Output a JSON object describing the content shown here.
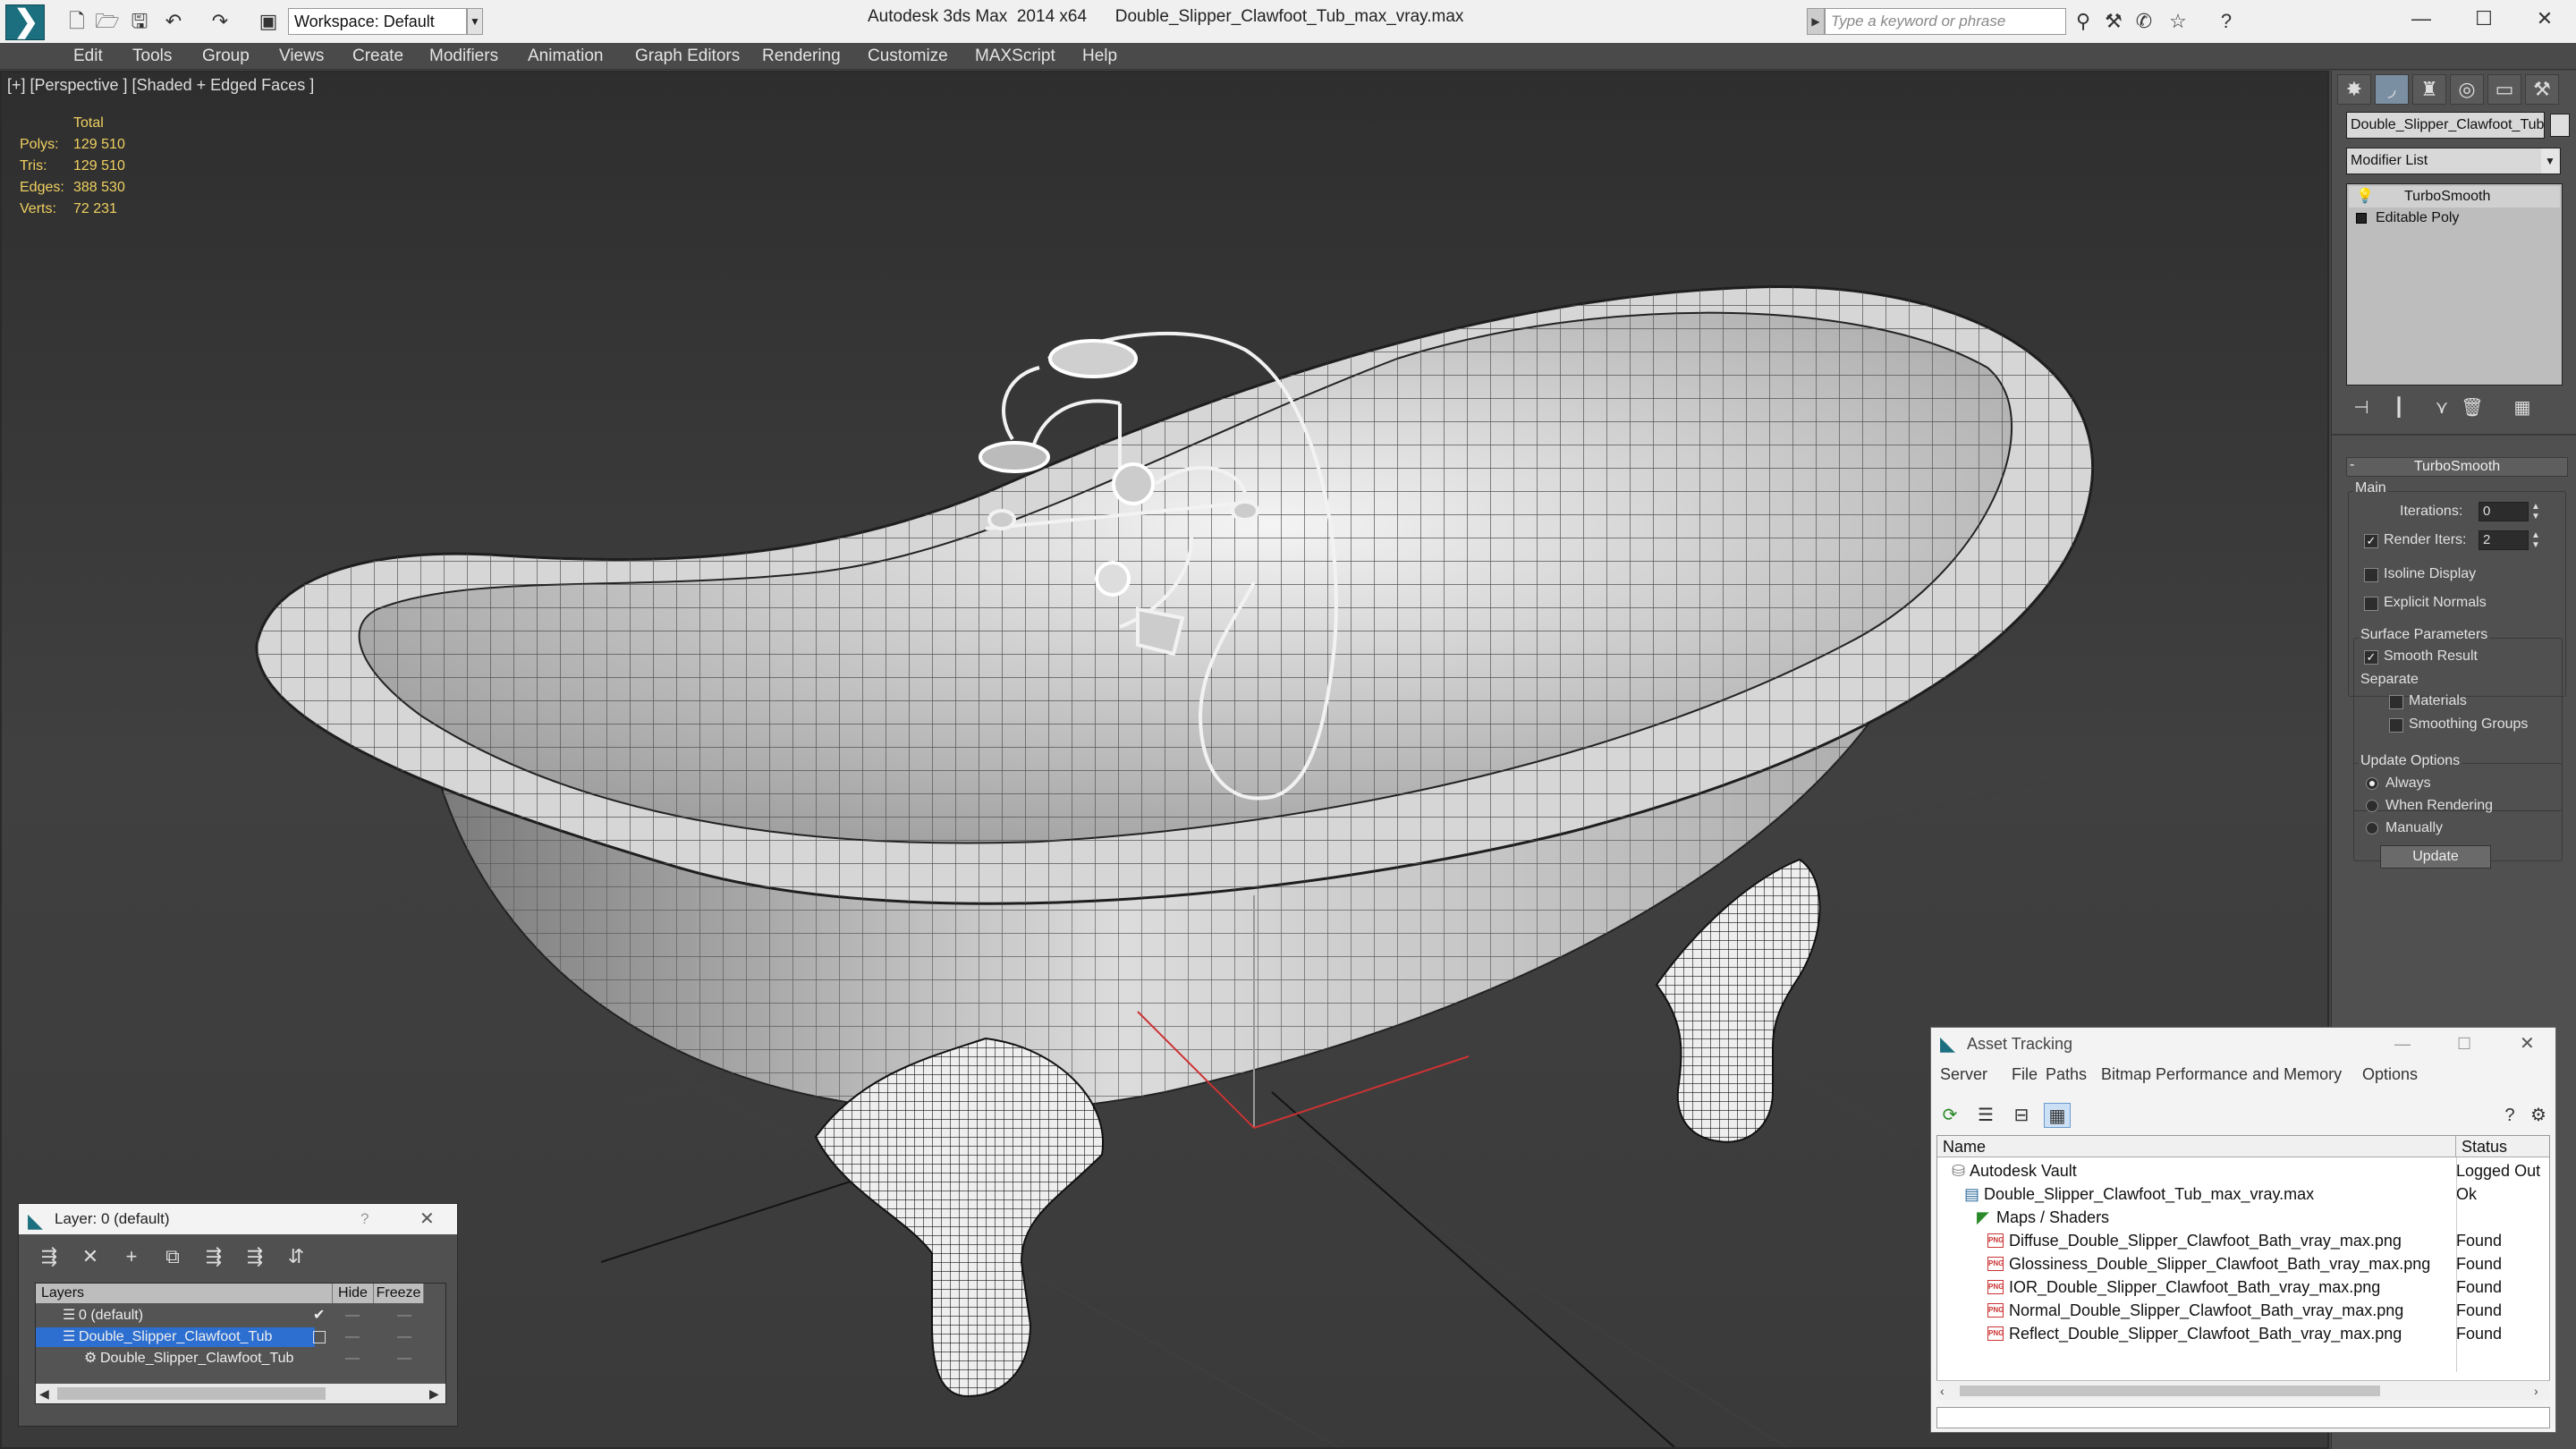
{
  "titlebar": {
    "workspace": "Workspace: Default",
    "app_title": "Autodesk 3ds Max  2014 x64",
    "file_title": "Double_Slipper_Clawfoot_Tub_max_vray.max",
    "search_placeholder": "Type a keyword or phrase"
  },
  "menu": [
    "Edit",
    "Tools",
    "Group",
    "Views",
    "Create",
    "Modifiers",
    "Animation",
    "Graph Editors",
    "Rendering",
    "Customize",
    "MAXScript",
    "Help"
  ],
  "viewport": {
    "label": "[+] [Perspective ] [Shaded + Edged Faces ]",
    "stats": {
      "header": "Total",
      "labels": [
        "Polys:",
        "Tris:",
        "Edges:",
        "Verts:"
      ],
      "values": [
        "129 510",
        "129 510",
        "388 530",
        "72 231"
      ]
    }
  },
  "command_panel": {
    "object_name": "Double_Slipper_Clawfoot_Tub",
    "modifier_list": "Modifier List",
    "stack": [
      "TurboSmooth",
      "Editable Poly"
    ],
    "rollout_title": "TurboSmooth",
    "main_group": "Main",
    "iterations_label": "Iterations:",
    "iterations_value": "0",
    "render_iters_label": "Render Iters:",
    "render_iters_value": "2",
    "isoline": "Isoline Display",
    "explicit_normals": "Explicit Normals",
    "surface_group": "Surface Parameters",
    "smooth_result": "Smooth Result",
    "separate": "Separate",
    "materials": "Materials",
    "smoothing_groups": "Smoothing Groups",
    "update_group": "Update Options",
    "always": "Always",
    "when_rendering": "When Rendering",
    "manually": "Manually",
    "update_btn": "Update"
  },
  "layer_window": {
    "title": "Layer: 0 (default)",
    "help": "?",
    "headers": [
      "Layers",
      "Hide",
      "Freeze"
    ],
    "rows": [
      "0 (default)",
      "Double_Slipper_Clawfoot_Tub",
      "Double_Slipper_Clawfoot_Tub"
    ]
  },
  "asset_window": {
    "title": "Asset Tracking",
    "menu": [
      "Server",
      "File",
      "Paths",
      "Bitmap Performance and Memory",
      "Options"
    ],
    "headers": [
      "Name",
      "Status"
    ],
    "rows": [
      {
        "name": "Autodesk Vault",
        "status": "Logged Out"
      },
      {
        "name": "Double_Slipper_Clawfoot_Tub_max_vray.max",
        "status": "Ok"
      },
      {
        "name": "Maps / Shaders",
        "status": ""
      },
      {
        "name": "Diffuse_Double_Slipper_Clawfoot_Bath_vray_max.png",
        "status": "Found"
      },
      {
        "name": "Glossiness_Double_Slipper_Clawfoot_Bath_vray_max.png",
        "status": "Found"
      },
      {
        "name": "IOR_Double_Slipper_Clawfoot_Bath_vray_max.png",
        "status": "Found"
      },
      {
        "name": "Normal_Double_Slipper_Clawfoot_Bath_vray_max.png",
        "status": "Found"
      },
      {
        "name": "Reflect_Double_Slipper_Clawfoot_Bath_vray_max.png",
        "status": "Found"
      }
    ],
    "png_tag": "PNG"
  }
}
